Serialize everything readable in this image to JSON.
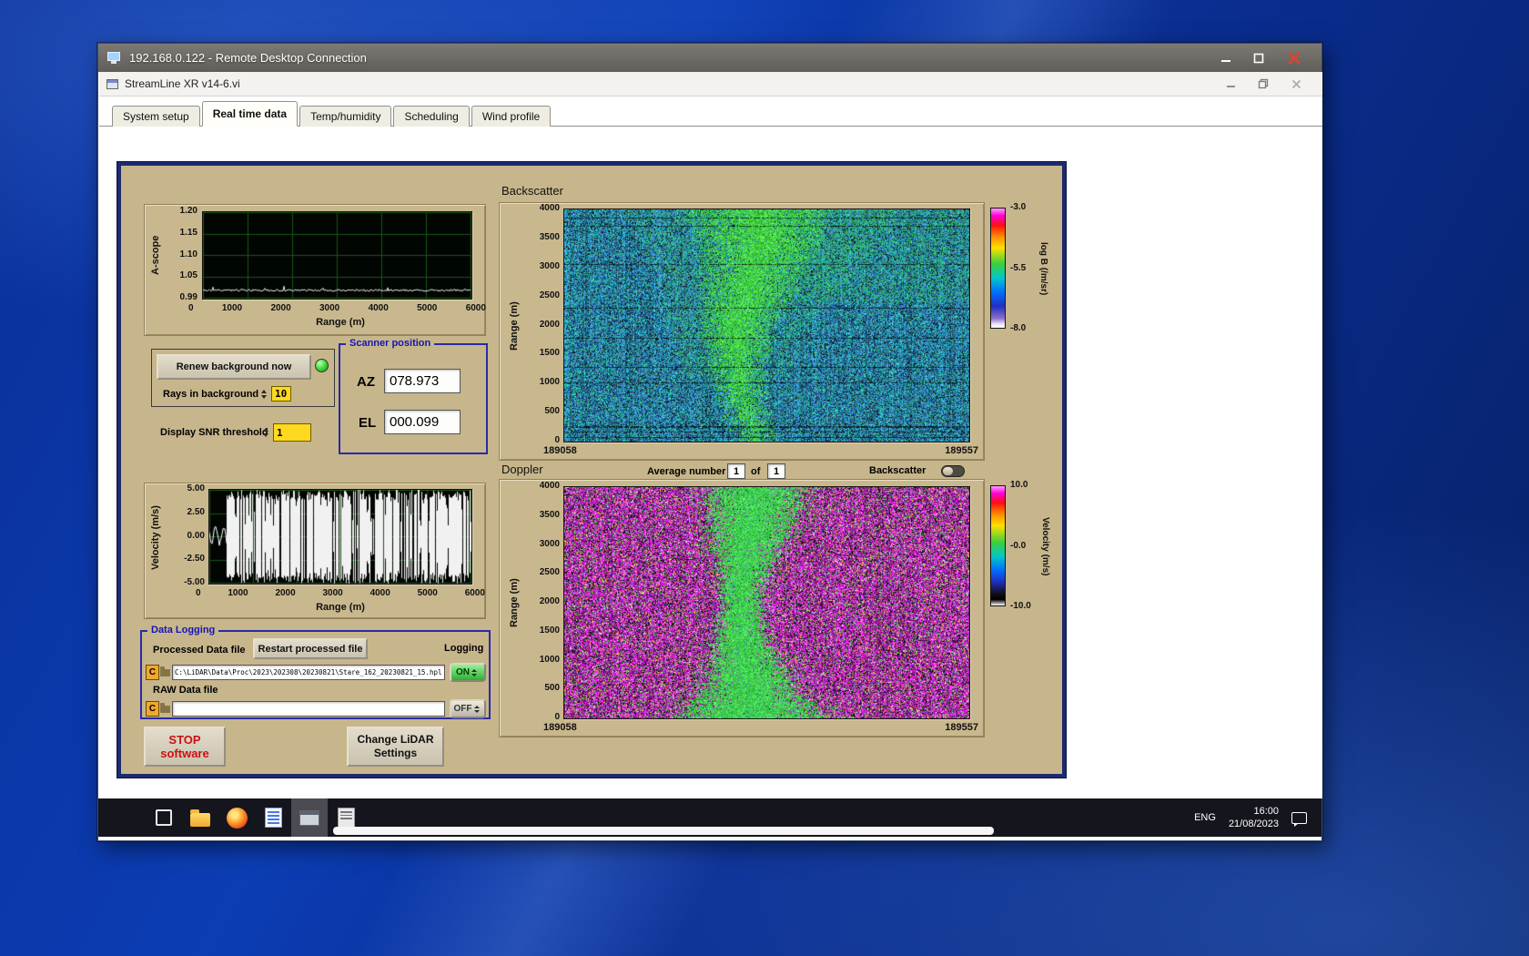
{
  "colors": {
    "panel": "#c7b68c",
    "accent_blue": "#1515b5",
    "led_green": "#35d435",
    "on_green": "#2fae2f"
  },
  "rdp": {
    "title": "192.168.0.122 - Remote Desktop Connection"
  },
  "app": {
    "title": "StreamLine XR v14-6.vi",
    "tabs": [
      {
        "label": "System setup"
      },
      {
        "label": "Real time data"
      },
      {
        "label": "Temp/humidity"
      },
      {
        "label": "Scheduling"
      },
      {
        "label": "Wind profile"
      }
    ]
  },
  "panel": {
    "ascope": {
      "ylabel": "A-scope",
      "xlabel": "Range (m)",
      "yticks": [
        "1.20",
        "1.15",
        "1.10",
        "1.05",
        "0.99"
      ],
      "xticks": [
        "0",
        "1000",
        "2000",
        "3000",
        "4000",
        "5000",
        "6000"
      ]
    },
    "controls": {
      "renew": "Renew background now",
      "rays_label": "Rays in background",
      "rays_value": "10",
      "snr_label": "Display SNR threshold",
      "snr_value": "1"
    },
    "scanner": {
      "title": "Scanner position",
      "az_label": "AZ",
      "az_value": "078.973",
      "el_label": "EL",
      "el_value": "000.099"
    },
    "backscatter": {
      "title": "Backscatter",
      "ylabel": "Range (m)",
      "yticks": [
        "4000",
        "3500",
        "3000",
        "2500",
        "2000",
        "1500",
        "1000",
        "500",
        "0"
      ],
      "x_start": "189058",
      "x_end": "189557",
      "cb_ticks": [
        "-3.0",
        "-5.5",
        "-8.0"
      ],
      "cb_label": "log B (/m/sr)"
    },
    "doppler": {
      "title": "Doppler",
      "avg_label": "Average number",
      "avg_value": "1",
      "of_label": "of",
      "of_count": "1",
      "toggle_label": "Backscatter",
      "ylabel": "Range (m)",
      "yticks": [
        "4000",
        "3500",
        "3000",
        "2500",
        "2000",
        "1500",
        "1000",
        "500",
        "0"
      ],
      "x_start": "189058",
      "x_end": "189557",
      "cb_ticks": [
        "10.0",
        "-0.0",
        "-10.0"
      ],
      "cb_label": "Velocity (m/s)"
    },
    "velocity": {
      "ylabel": "Velocity (m/s)",
      "xlabel": "Range (m)",
      "yticks": [
        "5.00",
        "2.50",
        "0.00",
        "-2.50",
        "-5.00"
      ],
      "xticks": [
        "0",
        "1000",
        "2000",
        "3000",
        "4000",
        "5000",
        "6000"
      ]
    },
    "logging": {
      "title": "Data Logging",
      "processed_label": "Processed Data file",
      "restart_button": "Restart processed file",
      "logging_label": "Logging",
      "drive": "C",
      "processed_path": "C:\\LiDAR\\Data\\Proc\\2023\\202308\\20230821\\Stare_162_20230821_15.hpl",
      "raw_label": "RAW Data file",
      "raw_path": "",
      "on_label": "ON",
      "off_label": "OFF"
    },
    "stop_button": {
      "line1": "STOP",
      "line2": "software"
    },
    "settings_button": {
      "line1": "Change LiDAR",
      "line2": "Settings"
    }
  },
  "taskbar": {
    "lang": "ENG",
    "time": "16:00",
    "date": "21/08/2023"
  },
  "chart_data": [
    {
      "type": "line",
      "title": "A-scope",
      "xlabel": "Range (m)",
      "ylabel": "A-scope",
      "xlim": [
        0,
        6000
      ],
      "ylim": [
        0.99,
        1.2
      ],
      "series_note": "flat noisy trace near 0.995 across full range"
    },
    {
      "type": "heatmap",
      "title": "Backscatter",
      "ylabel": "Range (m)",
      "ylim": [
        0,
        4000
      ],
      "x_range": [
        189058,
        189557
      ],
      "colorbar_label": "log B (/m/sr)",
      "colorbar_ticks": [
        -3.0,
        -5.5,
        -8.0
      ],
      "pattern": "blue noisy background, bright green plume column near centre widening with height"
    },
    {
      "type": "line",
      "title": "Velocity",
      "xlabel": "Range (m)",
      "ylabel": "Velocity (m/s)",
      "xlim": [
        0,
        6000
      ],
      "ylim": [
        -5,
        5
      ],
      "series_note": "dense full-scale noise beyond ~400 m, coherent trace near 0 at short range"
    },
    {
      "type": "heatmap",
      "title": "Doppler",
      "ylabel": "Range (m)",
      "ylim": [
        0,
        4000
      ],
      "x_range": [
        189058,
        189557
      ],
      "colorbar_label": "Velocity (m/s)",
      "colorbar_ticks": [
        10.0,
        -0.0,
        -10.0
      ],
      "pattern": "magenta noise background with central green low-velocity plume column"
    }
  ]
}
